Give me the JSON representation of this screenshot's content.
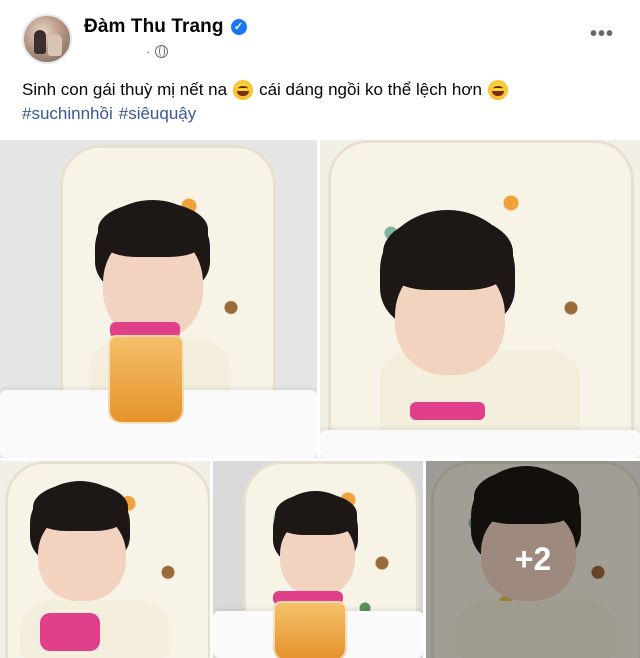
{
  "post": {
    "author_name": "Đàm Thu Trang",
    "meta_separator": "·",
    "more_menu": "•••",
    "caption_part1": "Sinh con gái thuỳ mị nết na",
    "caption_part2": "cái dáng ngồi ko thể lệch hơn",
    "hashtags": [
      "#suchinnhồi",
      "#siêuquậy"
    ],
    "more_photos_count": "+2"
  },
  "icons": {
    "verified": "verified-badge-icon",
    "privacy": "globe-icon",
    "emoji": "grinning-sweat-emoji"
  },
  "colors": {
    "brand_blue": "#1877f2",
    "hashtag_blue": "#385898",
    "secondary_text": "#65676b"
  }
}
